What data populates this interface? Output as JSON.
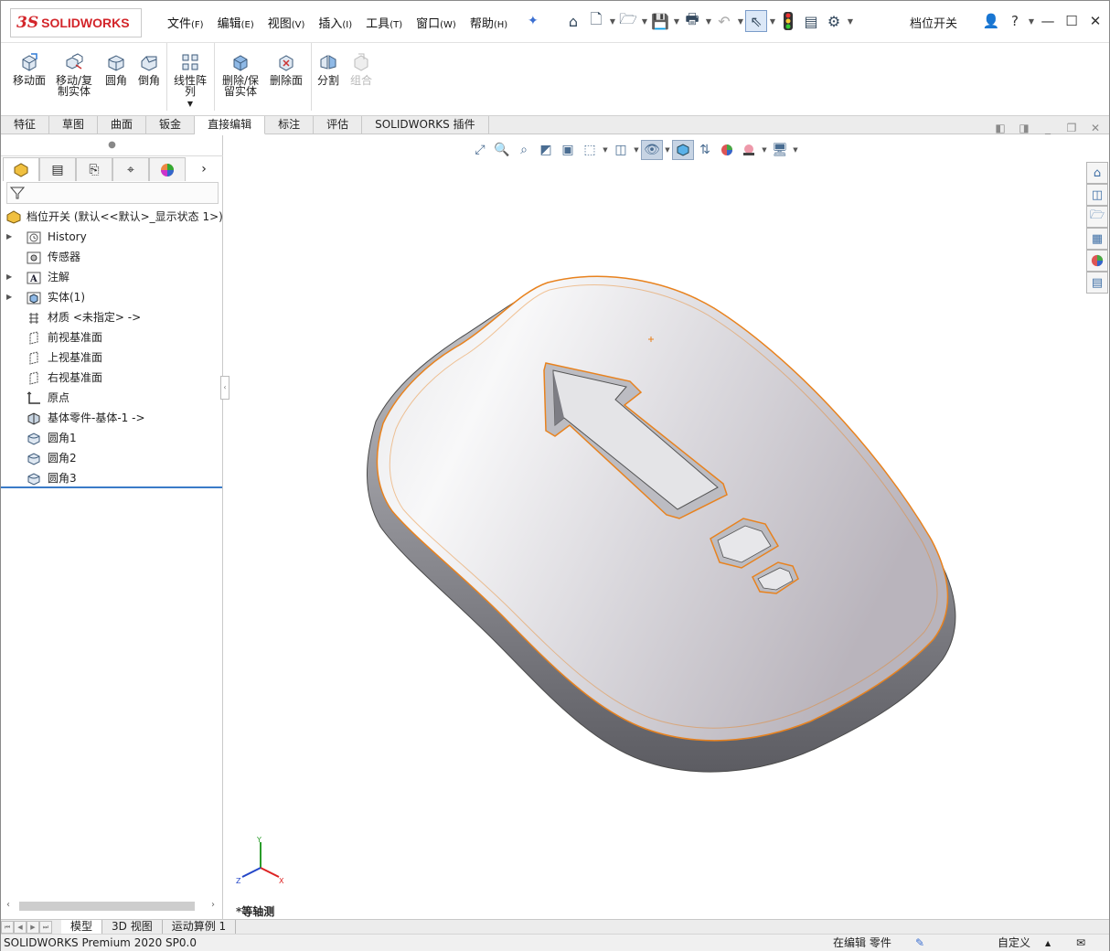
{
  "app": {
    "logo_ds": "3S",
    "logo_text": "SOLIDWORKS",
    "document_title": "档位开关"
  },
  "menu": [
    {
      "label": "文件",
      "key": "(F)"
    },
    {
      "label": "编辑",
      "key": "(E)"
    },
    {
      "label": "视图",
      "key": "(V)"
    },
    {
      "label": "插入",
      "key": "(I)"
    },
    {
      "label": "工具",
      "key": "(T)"
    },
    {
      "label": "窗口",
      "key": "(W)"
    },
    {
      "label": "帮助",
      "key": "(H)"
    }
  ],
  "ribbon": {
    "move_face": "移动面",
    "move_copy": "移动/复制实体",
    "fillet": "圆角",
    "chamfer": "倒角",
    "linear_pattern": "线性阵列",
    "delete_keep": "删除/保留实体",
    "delete_face": "删除面",
    "split": "分割",
    "combine": "组合"
  },
  "tabs": [
    "特征",
    "草图",
    "曲面",
    "钣金",
    "直接编辑",
    "标注",
    "评估",
    "SOLIDWORKS 插件"
  ],
  "active_tab": "直接编辑",
  "tree": {
    "root": "档位开关  (默认<<默认>_显示状态 1>)",
    "items": [
      {
        "label": "History",
        "icon": "history-icon",
        "expandable": true
      },
      {
        "label": "传感器",
        "icon": "sensor-icon",
        "expandable": false
      },
      {
        "label": "注解",
        "icon": "annotation-icon",
        "expandable": true
      },
      {
        "label": "实体(1)",
        "icon": "solid-bodies-icon",
        "expandable": true
      },
      {
        "label": "材质 <未指定> ->",
        "icon": "material-icon",
        "expandable": false
      },
      {
        "label": "前视基准面",
        "icon": "plane-icon",
        "expandable": false
      },
      {
        "label": "上视基准面",
        "icon": "plane-icon",
        "expandable": false
      },
      {
        "label": "右视基准面",
        "icon": "plane-icon",
        "expandable": false
      },
      {
        "label": "原点",
        "icon": "origin-icon",
        "expandable": false
      },
      {
        "label": "基体零件-基体-1 ->",
        "icon": "base-part-icon",
        "expandable": false
      },
      {
        "label": "圆角1",
        "icon": "fillet-feature-icon",
        "expandable": false
      },
      {
        "label": "圆角2",
        "icon": "fillet-feature-icon",
        "expandable": false
      },
      {
        "label": "圆角3",
        "icon": "fillet-feature-icon",
        "expandable": false
      }
    ]
  },
  "bottom_tabs": [
    "模型",
    "3D 视图",
    "运动算例 1"
  ],
  "view_label": "*等轴测",
  "triad": {
    "x": "X",
    "y": "Y",
    "z": "Z"
  },
  "status": {
    "product": "SOLIDWORKS Premium 2020 SP0.0",
    "mode": "在编辑 零件",
    "units": "自定义"
  },
  "colors": {
    "brand": "#d3252a",
    "selection_edge": "#e8821e",
    "accent": "#3a7bc8"
  }
}
